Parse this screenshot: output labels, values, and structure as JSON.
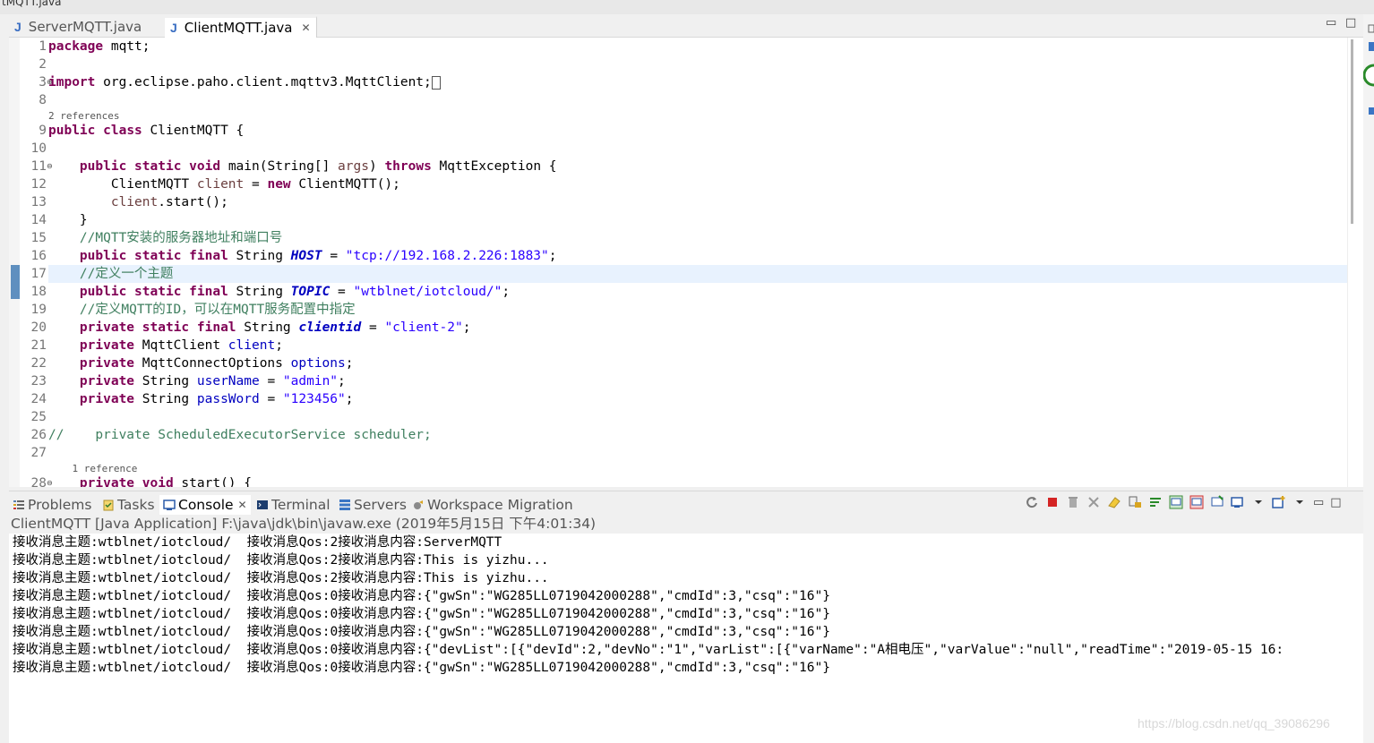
{
  "window": {
    "title_fragment": "tMQTT.java"
  },
  "editor": {
    "tabs": [
      {
        "label": "ServerMQTT.java",
        "icon": "java-file-icon"
      },
      {
        "label": "ClientMQTT.java",
        "icon": "java-file-icon",
        "close": "✕"
      }
    ],
    "line_numbers": [
      "1",
      "2",
      "3",
      "8",
      "9",
      "10",
      "11",
      "12",
      "13",
      "14",
      "15",
      "16",
      "17",
      "18",
      "19",
      "20",
      "21",
      "22",
      "23",
      "24",
      "25",
      "26",
      "27",
      "28"
    ],
    "references": [
      "2 references",
      "1 reference"
    ],
    "code": {
      "l1": "mqtt;",
      "l3": " org.eclipse.paho.client.mqttv3.MqttClient;",
      "l9": " ClientMQTT {",
      "l11_a": "main(String[] ",
      "l11_b": "args",
      "l11_c": ") ",
      "l11_d": " MqttException {",
      "l12_a": "        ClientMQTT ",
      "l12_b": "client",
      "l12_c": " = ",
      "l12_d": " ClientMQTT();",
      "l13_a": "        ",
      "l13_b": "client",
      "l13_c": ".start();",
      "l14": "    }",
      "l15": "    //MQTT安装的服务器地址和端口号",
      "l16_name": "HOST",
      "l16_val": "\"tcp://192.168.2.226:1883\"",
      "l17": "    //定义一个主题",
      "l18_name": "TOPIC",
      "l18_val": "\"wtblnet/iotcloud/\"",
      "l19": "    //定义MQTT的ID，可以在MQTT服务配置中指定",
      "l20_name": "clientid",
      "l20_val": "\"client-2\"",
      "l21_type": " MqttClient ",
      "l21_name": "client",
      "l22_type": " MqttConnectOptions ",
      "l22_name": "options",
      "l23_name": "userName",
      "l23_val": "\"admin\"",
      "l24_name": "passWord",
      "l24_val": "\"123456\"",
      "l26": "//    private ScheduledExecutorService scheduler;",
      "l28": " start() {"
    },
    "keywords": {
      "package": "package",
      "import": "import",
      "public": "public",
      "class": "class",
      "static": "static",
      "void": "void",
      "throws": "throws",
      "new": "new",
      "final": "final",
      "private": "private",
      "String": " String "
    }
  },
  "console": {
    "tabs": [
      {
        "label": "Problems",
        "icon": "problems-icon"
      },
      {
        "label": "Tasks",
        "icon": "tasks-icon"
      },
      {
        "label": "Console",
        "icon": "console-icon",
        "close": "✕"
      },
      {
        "label": "Terminal",
        "icon": "terminal-icon"
      },
      {
        "label": "Servers",
        "icon": "servers-icon"
      },
      {
        "label": "Workspace Migration",
        "icon": "migration-icon"
      }
    ],
    "process": "ClientMQTT [Java Application] F:\\java\\jdk\\bin\\javaw.exe (2019年5月15日 下午4:01:34)",
    "lines": [
      "接收消息主题:wtblnet/iotcloud/  接收消息Qos:2接收消息内容:ServerMQTT",
      "接收消息主题:wtblnet/iotcloud/  接收消息Qos:2接收消息内容:This is yizhu...",
      "接收消息主题:wtblnet/iotcloud/  接收消息Qos:2接收消息内容:This is yizhu...",
      "接收消息主题:wtblnet/iotcloud/  接收消息Qos:0接收消息内容:{\"gwSn\":\"WG285LL0719042000288\",\"cmdId\":3,\"csq\":\"16\"}",
      "接收消息主题:wtblnet/iotcloud/  接收消息Qos:0接收消息内容:{\"gwSn\":\"WG285LL0719042000288\",\"cmdId\":3,\"csq\":\"16\"}",
      "接收消息主题:wtblnet/iotcloud/  接收消息Qos:0接收消息内容:{\"gwSn\":\"WG285LL0719042000288\",\"cmdId\":3,\"csq\":\"16\"}",
      "接收消息主题:wtblnet/iotcloud/  接收消息Qos:0接收消息内容:{\"devList\":[{\"devId\":2,\"devNo\":\"1\",\"varList\":[{\"varName\":\"A相电压\",\"varValue\":\"null\",\"readTime\":\"2019-05-15 16:",
      "接收消息主题:wtblnet/iotcloud/  接收消息Qos:0接收消息内容:{\"gwSn\":\"WG285LL0719042000288\",\"cmdId\":3,\"csq\":\"16\"}"
    ]
  },
  "window_controls": {
    "minimize": "▭",
    "maximize": "□"
  },
  "watermark": "https://blog.csdn.net/qq_39086296"
}
